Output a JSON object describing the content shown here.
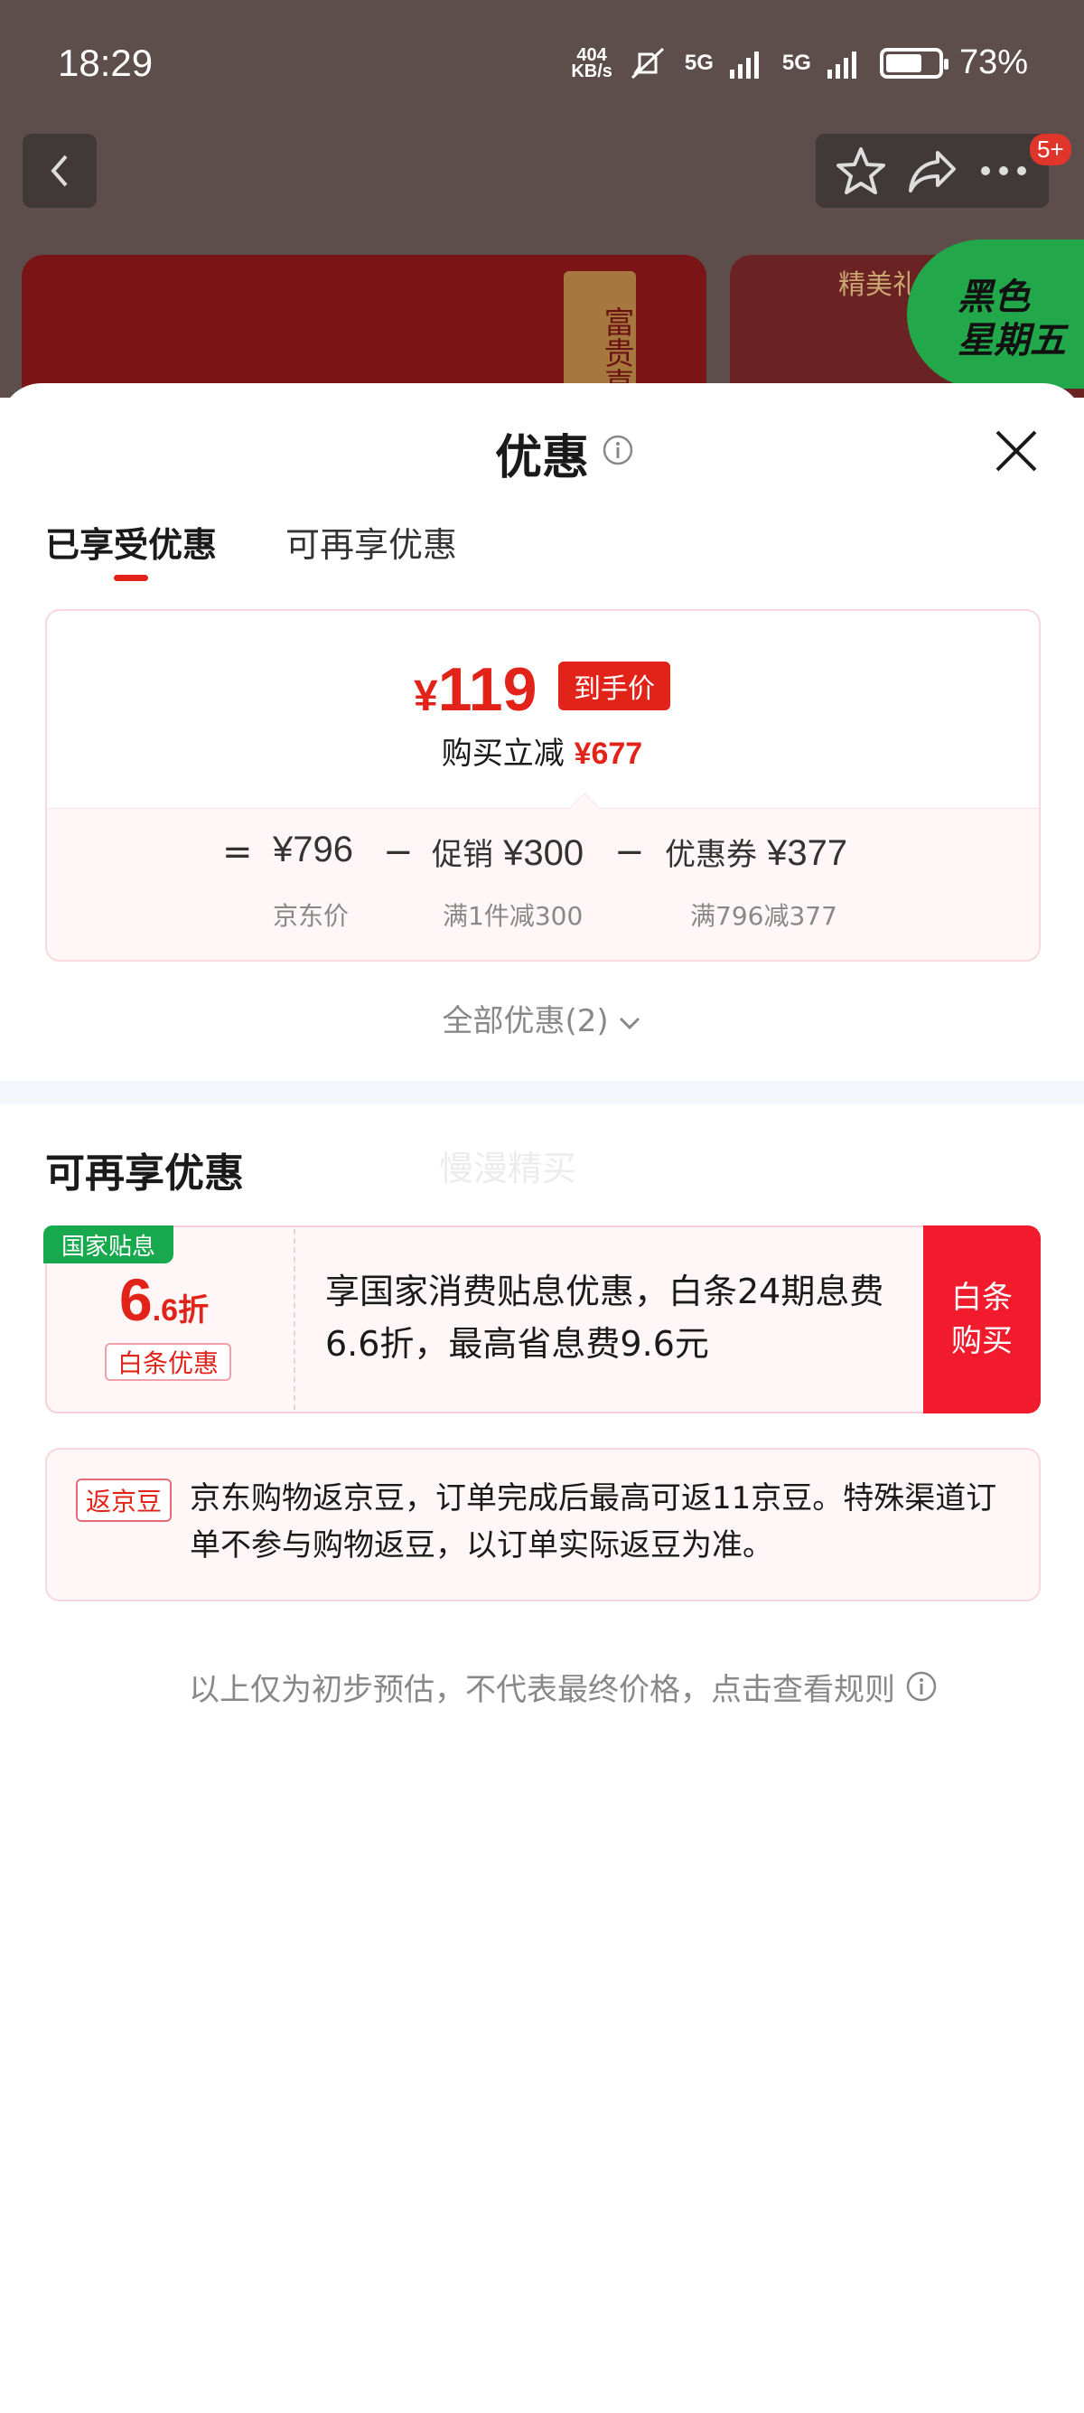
{
  "status_bar": {
    "time": "18:29",
    "net_speed_top": "404",
    "net_speed_bottom": "KB/s",
    "sim1": "5G",
    "sim2": "5G",
    "battery": "73%"
  },
  "background": {
    "badge": "5+",
    "scroll_text": "富贵喜福",
    "card2_title": "精美礼",
    "promo_badge_line1": "黑色",
    "promo_badge_line2": "星期五"
  },
  "sheet": {
    "title": "优惠",
    "tabs": [
      {
        "label": "已享受优惠",
        "active": true
      },
      {
        "label": "可再享优惠",
        "active": false
      }
    ]
  },
  "price_summary": {
    "final_price_symbol": "¥",
    "final_price": "119",
    "final_price_tag": "到手价",
    "reduce_label": "购买立减",
    "reduce_amount": "¥677",
    "formula": {
      "equals": "=",
      "minus": "−",
      "jd_price": "¥796",
      "jd_price_label": "京东价",
      "promo_label": "促销",
      "promo_value": "¥300",
      "promo_sub": "满1件减300",
      "coupon_label": "优惠券",
      "coupon_value": "¥377",
      "coupon_sub": "满796减377"
    },
    "all_offers": "全部优惠(2)"
  },
  "more_offers": {
    "title": "可再享优惠",
    "watermark": "慢漫精买",
    "baitiao": {
      "tag": "国家贴息",
      "discount_big": "6",
      "discount_small": ".6折",
      "label": "白条优惠",
      "description": "享国家消费贴息优惠，白条24期息费6.6折，最高省息费9.6元",
      "buy_button": "白条购买"
    },
    "beans": {
      "tag": "返京豆",
      "text": "京东购物返京豆，订单完成后最高可返11京豆。特殊渠道订单不参与购物返豆，以订单实际返豆为准。"
    }
  },
  "footnote": "以上仅为初步预估，不代表最终价格，点击查看规则",
  "colors": {
    "brand_red": "#e2231a",
    "buy_red": "#f21b2d",
    "gov_green": "#18a84e"
  }
}
